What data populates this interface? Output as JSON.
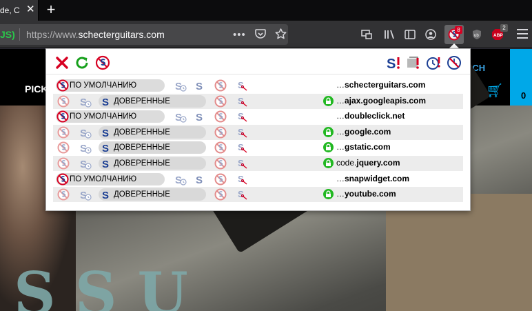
{
  "browser": {
    "tab": {
      "title": "de, C"
    },
    "url": {
      "identity": "JS)",
      "prefix": "https://www.",
      "domain": "schecterguitars.com"
    },
    "extensions": [
      {
        "name": "noscript",
        "badge": "8"
      },
      {
        "name": "ublock-origin"
      },
      {
        "name": "adblock",
        "badge": "2"
      }
    ]
  },
  "site": {
    "nav_left": "PICK",
    "nav_right": "RCH",
    "cart_count": "0",
    "hero_logo": "SSU"
  },
  "popup": {
    "rows": [
      {
        "trust": "default",
        "label": "ПО УМОЛЧАНИЮ",
        "secure": false,
        "prefix": "…",
        "domain": "schecterguitars.com"
      },
      {
        "trust": "trusted",
        "label": "ДОВЕРЕННЫЕ",
        "secure": true,
        "prefix": "…",
        "domain": "ajax.googleapis.com"
      },
      {
        "trust": "default",
        "label": "ПО УМОЛЧАНИЮ",
        "secure": false,
        "prefix": "…",
        "domain": "doubleclick.net"
      },
      {
        "trust": "trusted",
        "label": "ДОВЕРЕННЫЕ",
        "secure": true,
        "prefix": "…",
        "domain": "google.com"
      },
      {
        "trust": "trusted",
        "label": "ДОВЕРЕННЫЕ",
        "secure": true,
        "prefix": "…",
        "domain": "gstatic.com"
      },
      {
        "trust": "trusted",
        "label": "ДОВЕРЕННЫЕ",
        "secure": true,
        "prefix": "code.",
        "domain": "jquery.com"
      },
      {
        "trust": "default",
        "label": "ПО УМОЛЧАНИЮ",
        "secure": false,
        "prefix": "…",
        "domain": "snapwidget.com"
      },
      {
        "trust": "trusted",
        "label": "ДОВЕРЕННЫЕ",
        "secure": true,
        "prefix": "…",
        "domain": "youtube.com"
      }
    ]
  },
  "colors": {
    "trusted_blue": "#1c3f94",
    "untrusted_red": "#d70022",
    "lock_green": "#22b822",
    "popup_row_alt": "#ececec"
  }
}
